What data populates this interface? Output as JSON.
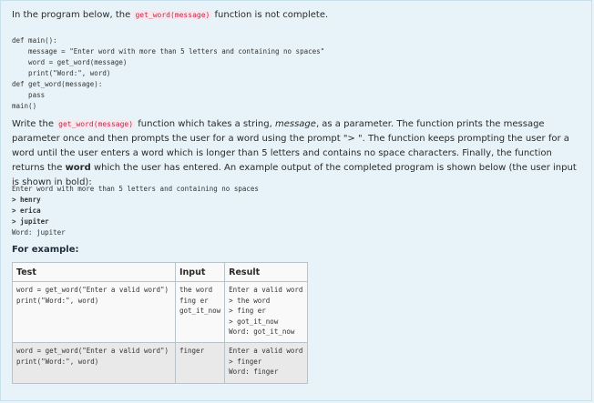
{
  "intro": {
    "before": "In the program below, the ",
    "code": "get_word(message)",
    "after": " function is not complete."
  },
  "program": [
    "def main():",
    "    message = \"Enter word with more than 5 letters and containing no spaces\"",
    "    word = get_word(message)",
    "    print(\"Word:\", word)",
    "def get_word(message):",
    "    pass",
    "main()"
  ],
  "description": {
    "t1": "Write the ",
    "code": "get_word(message)",
    "t2": " function which takes a string, ",
    "param": "message",
    "t3": ", as a parameter. The function prints the message parameter once and then prompts the user for a word using the prompt \"> \". The function keeps prompting the user for a word until the user enters a word which is longer than 5 letters and contains no space characters. Finally, the function returns the ",
    "bold": "word",
    "t4": " which the user has entered. An example output of the completed program is shown below (the user input is shown in bold):"
  },
  "example_output": [
    {
      "text": "Enter word with more than 5 letters and containing no spaces",
      "bold": false
    },
    {
      "text": "> henry",
      "bold": true
    },
    {
      "text": "> erica",
      "bold": true
    },
    {
      "text": "> jupiter",
      "bold": true
    },
    {
      "text": "Word: jupiter",
      "bold": false
    }
  ],
  "for_example_heading": "For example:",
  "table": {
    "headers": [
      "Test",
      "Input",
      "Result"
    ],
    "rows": [
      {
        "test": "word = get_word(\"Enter a valid word\")\nprint(\"Word:\", word)",
        "input": "the word\nfing er\ngot_it_now",
        "result": "Enter a valid word\n> the word\n> fing er\n> got_it_now\nWord: got_it_now"
      },
      {
        "test": "word = get_word(\"Enter a valid word\")\nprint(\"Word:\", word)",
        "input": "finger",
        "result": "Enter a valid word\n> finger\nWord: finger"
      }
    ]
  }
}
